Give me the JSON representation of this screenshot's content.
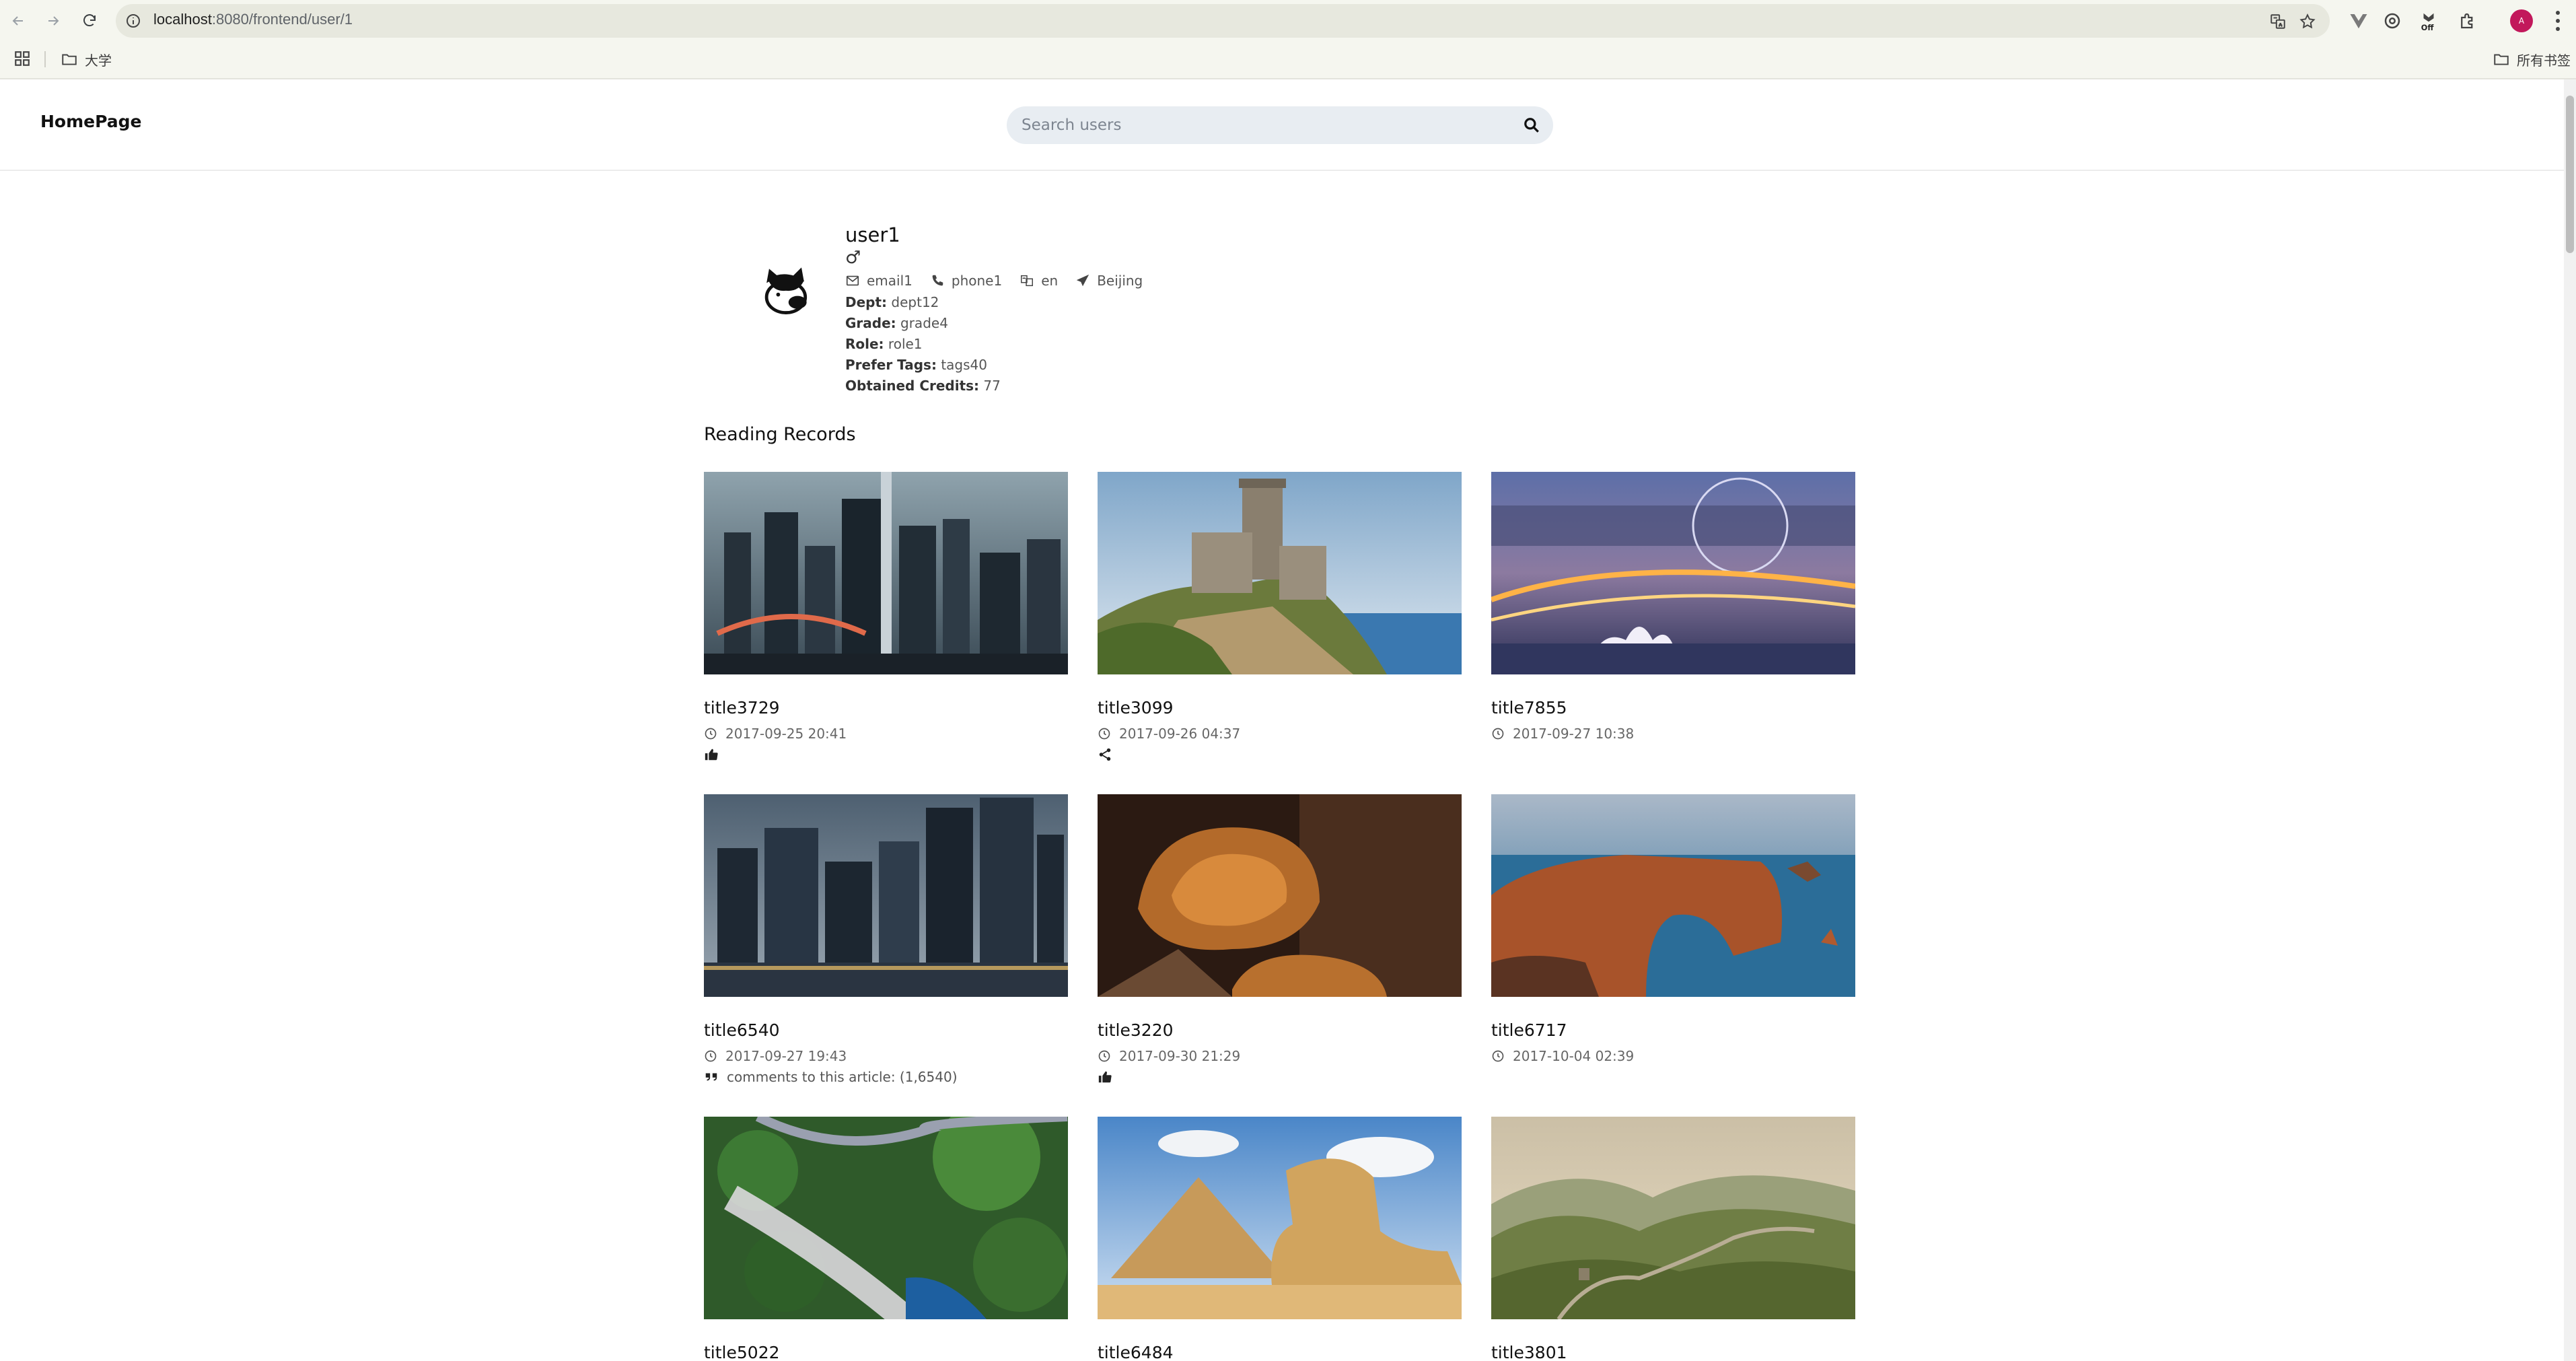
{
  "browser": {
    "url_host": "localhost",
    "url_path": ":8080/frontend/user/1",
    "bookmarks": [
      {
        "label": "大学"
      },
      {
        "label": "所有书签"
      }
    ],
    "profile_initial": "A"
  },
  "header": {
    "brand": "HomePage",
    "search_placeholder": "Search users"
  },
  "profile": {
    "username": "user1",
    "gender_symbol": "♂",
    "email": "email1",
    "phone": "phone1",
    "language": "en",
    "location": "Beijing",
    "fields": [
      {
        "label": "Dept:",
        "value": "dept12"
      },
      {
        "label": "Grade:",
        "value": "grade4"
      },
      {
        "label": "Role:",
        "value": "role1"
      },
      {
        "label": "Prefer Tags:",
        "value": "tags40"
      },
      {
        "label": "Obtained Credits:",
        "value": "77"
      }
    ]
  },
  "reading_records": {
    "title": "Reading Records",
    "items": [
      {
        "title": "title3729",
        "date": "2017-09-25 20:41",
        "action_icon": "thumbs-up-icon",
        "action_text": "",
        "image": "city skyline at dusk"
      },
      {
        "title": "title3099",
        "date": "2017-09-26 04:37",
        "action_icon": "share-icon",
        "action_text": "",
        "image": "castle tower on cliff"
      },
      {
        "title": "title7855",
        "date": "2017-09-27 10:38",
        "action_icon": "",
        "action_text": "",
        "image": "city night with ferris wheel"
      },
      {
        "title": "title6540",
        "date": "2017-09-27 19:43",
        "action_icon": "quote-icon",
        "action_text": "comments to this article: (1,6540)",
        "image": "skyscrapers waterfront at dusk"
      },
      {
        "title": "title3220",
        "date": "2017-09-30 21:29",
        "action_icon": "thumbs-up-icon",
        "action_text": "",
        "image": "croissants on wooden board"
      },
      {
        "title": "title6717",
        "date": "2017-10-04 02:39",
        "action_icon": "",
        "action_text": "",
        "image": "sea arch rock formation"
      },
      {
        "title": "title5022",
        "date": "",
        "action_icon": "",
        "action_text": "",
        "image": "aerial forest and waterfall"
      },
      {
        "title": "title6484",
        "date": "",
        "action_icon": "",
        "action_text": "",
        "image": "sphinx and pyramid"
      },
      {
        "title": "title3801",
        "date": "",
        "action_icon": "",
        "action_text": "",
        "image": "great wall mountains"
      }
    ]
  }
}
